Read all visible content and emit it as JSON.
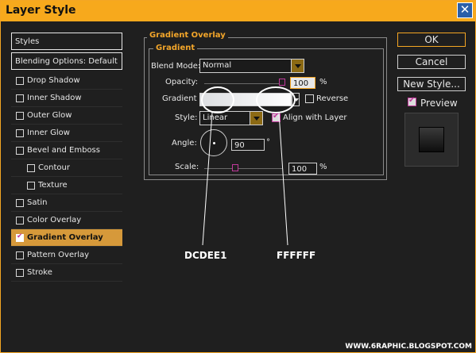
{
  "window": {
    "title": "Layer Style",
    "close_glyph": "✕"
  },
  "sidebar": {
    "header": "Styles",
    "blending": "Blending Options: Default",
    "items": [
      {
        "label": "Drop Shadow",
        "checked": false
      },
      {
        "label": "Inner Shadow",
        "checked": false
      },
      {
        "label": "Outer Glow",
        "checked": false
      },
      {
        "label": "Inner Glow",
        "checked": false
      },
      {
        "label": "Bevel and Emboss",
        "checked": false
      },
      {
        "label": "Contour",
        "checked": false,
        "sub": true
      },
      {
        "label": "Texture",
        "checked": false,
        "sub": true
      },
      {
        "label": "Satin",
        "checked": false
      },
      {
        "label": "Color Overlay",
        "checked": false
      },
      {
        "label": "Gradient Overlay",
        "checked": true,
        "active": true
      },
      {
        "label": "Pattern Overlay",
        "checked": false
      },
      {
        "label": "Stroke",
        "checked": false
      }
    ]
  },
  "panel": {
    "title": "Gradient Overlay",
    "section": "Gradient",
    "blend_mode_label": "Blend Mode:",
    "blend_mode_value": "Normal",
    "opacity_label": "Opacity:",
    "opacity_value": "100",
    "opacity_unit": "%",
    "opacity_level": 1.0,
    "gradient_label": "Gradient",
    "reverse_label": "Reverse",
    "reverse_checked": false,
    "style_label": "Style:",
    "style_value": "Linear",
    "align_label": "Align with Layer",
    "align_checked": true,
    "angle_label": "Angle:",
    "angle_value": "90",
    "angle_unit": "°",
    "scale_label": "Scale:",
    "scale_value": "100",
    "scale_unit": "%",
    "scale_level": 0.4
  },
  "buttons": {
    "ok": "OK",
    "cancel": "Cancel",
    "new_style": "New Style...",
    "preview": "Preview",
    "preview_checked": true
  },
  "annotations": {
    "left_color": "DCDEE1",
    "right_color": "FFFFFF"
  },
  "colors": {
    "accent": "#f7a91c",
    "gradient_start": "#dcdee1",
    "gradient_end": "#ffffff",
    "active_row": "#d6993a"
  },
  "watermark": "WWW.6RAPHIC.BLOGSPOT.COM"
}
